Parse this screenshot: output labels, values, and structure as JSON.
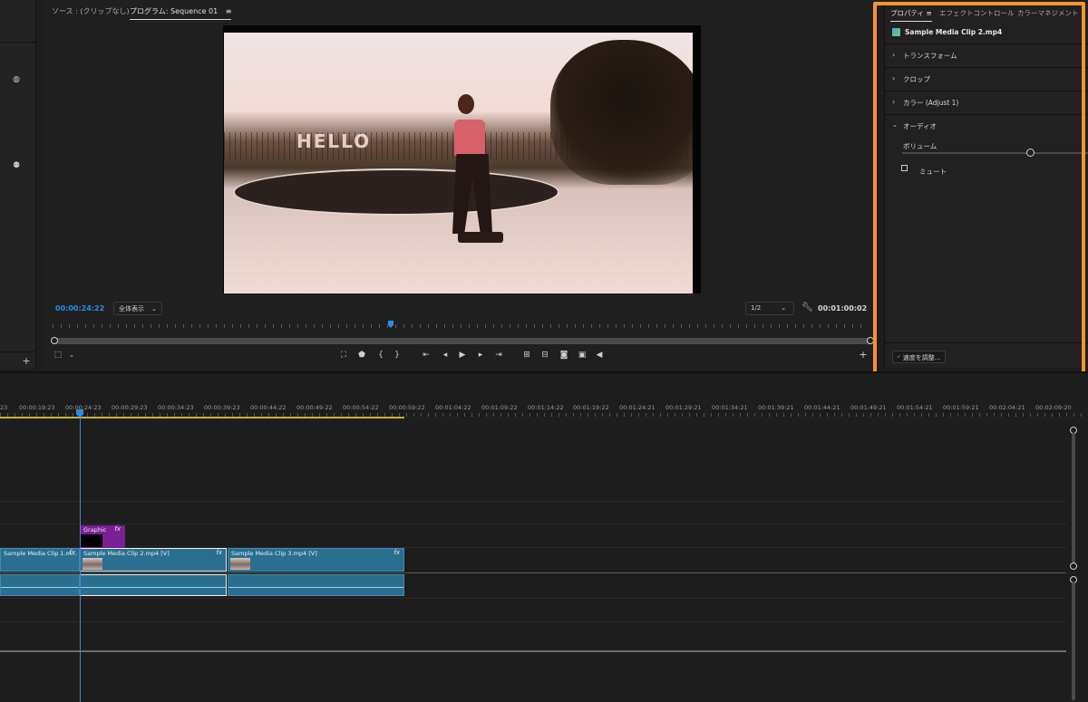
{
  "source_tab": "ソース : (クリップなし)",
  "program_tab": "プログラム: Sequence 01",
  "menu_icon": "≡",
  "video_overlay_text": "HELLO",
  "current_timecode": "00:00:24:22",
  "fit_dropdown": "全体表示",
  "resolution_dropdown": "1/2",
  "duration_timecode": "00:01:00:02",
  "properties": {
    "tabs": [
      "プロパティ",
      "エフェクトコントロール",
      "カラーマネジメント"
    ],
    "clip_name": "Sample Media Clip 2.mp4",
    "sections": [
      "トランスフォーム",
      "クロップ",
      "カラー (Adjust 1)",
      "オーディオ"
    ],
    "volume_label": "ボリューム",
    "mute_label": "ミュート",
    "speed_button": "速度を調整..."
  },
  "timeline": {
    "timecodes": [
      "23",
      "00:00:19:23",
      "00:00:24:23",
      "00:00:29:23",
      "00:00:34:23",
      "00:00:39:23",
      "00:00:44:22",
      "00:00:49:22",
      "00:00:54:22",
      "00:00:59:22",
      "00:01:04:22",
      "00:01:09:22",
      "00:01:14:22",
      "00:01:19:22",
      "00:01:24:21",
      "00:01:29:21",
      "00:01:34:21",
      "00:01:39:21",
      "00:01:44:21",
      "00:01:49:21",
      "00:01:54:21",
      "00:01:59:21",
      "00:02:04:21",
      "00:02:09:20"
    ],
    "graphic_clip": "Graphic",
    "fx": "fx",
    "video_clips": [
      "Sample Media Clip 1.m...",
      "Sample Media Clip 2.mp4 [V]",
      "Sample Media Clip 3.mp4 [V]"
    ]
  },
  "colors": {
    "accent_blue": "#2d8ceb",
    "highlight_orange": "#f3962a",
    "clip_teal": "#2a6f8f",
    "graphic_purple": "#7b1f94",
    "work_area_yellow": "#c9b42b"
  }
}
